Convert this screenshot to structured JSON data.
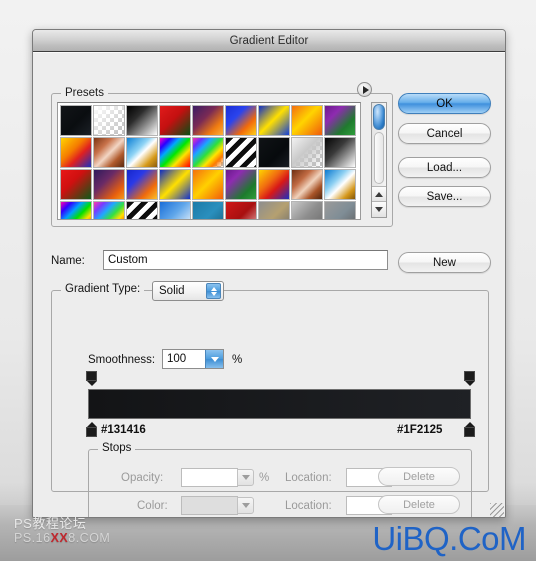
{
  "window": {
    "title": "Gradient Editor"
  },
  "presets": {
    "legend": "Presets",
    "flyout_icon": "flyout-triangle-icon",
    "scrollbar": {
      "thumb_color": "#3f90dd",
      "up_icon": "triangle-up-icon",
      "down_icon": "triangle-down-icon"
    },
    "swatches": [
      {
        "name": "black-dark-navy",
        "css": "linear-gradient(135deg,#121518 0%,#0a0d10 55%,#1b2026 100%)"
      },
      {
        "name": "white-to-transparent",
        "css": "linear-gradient(135deg,#ffffff 0%,rgba(255,255,255,0) 100%)",
        "checker": true
      },
      {
        "name": "black-to-white",
        "css": "linear-gradient(135deg,#000000 0%,#2b2b2b 35%,#ffffff 100%)"
      },
      {
        "name": "red-to-green",
        "css": "linear-gradient(135deg,#e01b1b 0%,#c41010 45%,#0a4d14 100%)"
      },
      {
        "name": "violet-orange",
        "css": "linear-gradient(135deg,#3a1c63 0%,#7a2a55 40%,#f07c10 75%,#fbb03b 100%)"
      },
      {
        "name": "blue-orange",
        "css": "linear-gradient(135deg,#1b2fd6 0%,#2a44ee 35%,#f26a0a 70%,#fdd017 100%)"
      },
      {
        "name": "blue-yellow-blue",
        "css": "linear-gradient(135deg,#0f2fc8 0%,#ffe000 48%,#123fd8 100%)"
      },
      {
        "name": "orange-yellow",
        "css": "linear-gradient(135deg,#f36f12 0%,#ffd400 45%,#f05a0c 100%)"
      },
      {
        "name": "purple-green",
        "css": "linear-gradient(135deg,#6d1a8e 0%,#8e2bb0 30%,#1f7a2e 70%,#2f9e3c 100%)"
      },
      {
        "name": "yellow-orange-blue",
        "css": "linear-gradient(135deg,#ffd400 0%,#f57c00 40%,#e02020 62%,#1a2fc0 100%)"
      },
      {
        "name": "copper",
        "css": "linear-gradient(135deg,#7a3414 0%,#c8724a 30%,#f2d6c4 52%,#b05a2c 75%,#5a2a10 100%)"
      },
      {
        "name": "blue-white-gold",
        "css": "linear-gradient(135deg,#0d7fd4 0%,#8fd4f5 38%,#ffffff 52%,#d79b1a 78%,#8a5c0d 100%)"
      },
      {
        "name": "spectrum",
        "css": "linear-gradient(135deg,#ff00c8 0%,#2a00ff 18%,#00a8ff 34%,#00e800 52%,#ffe400 70%,#ff6a00 85%,#ff0000 100%)"
      },
      {
        "name": "spectrum-transparent",
        "css": "linear-gradient(135deg,#ff2fa8 0%,#6a2cff 16%,#1aa8ff 32%,#2fe03a 50%,#ffe400 66%,#ff7b00 80%,rgba(255,255,255,0) 100%)",
        "checker": true
      },
      {
        "name": "black-white-stripes",
        "css": "repeating-linear-gradient(135deg,#0d0d0d 0 5px,#ffffff 5px 10px)"
      },
      {
        "name": "near-black",
        "css": "linear-gradient(135deg,#101316 0%,#070a0d 60%,#191d23 100%)"
      },
      {
        "name": "silver-transparent",
        "css": "linear-gradient(135deg,#f2f2f2 0%,#c9c9c9 45%,rgba(255,255,255,0) 100%)",
        "checker": true
      },
      {
        "name": "black-to-white-2",
        "css": "linear-gradient(135deg,#050505 0%,#3a3a3a 40%,#ffffff 100%)"
      },
      {
        "name": "red-green-2",
        "css": "linear-gradient(135deg,#e81818 0%,#cf1010 40%,#0d5a18 100%)"
      },
      {
        "name": "violet-orange-2",
        "css": "linear-gradient(135deg,#2e1a5c 0%,#6a2a66 38%,#e8600d 78%,#f59a17 100%)"
      },
      {
        "name": "blue-orange-2",
        "css": "linear-gradient(135deg,#1626cc 0%,#2a3ae8 32%,#ef6a0c 72%,#fbc02d 100%)"
      },
      {
        "name": "blue-yellow-2",
        "css": "linear-gradient(135deg,#0e2cc4 0%,#ffe000 50%,#1130cf 100%)"
      },
      {
        "name": "orange-yellow-2",
        "css": "linear-gradient(135deg,#f4700f 0%,#ffd000 48%,#f25c0a 100%)"
      },
      {
        "name": "purple-green-2",
        "css": "linear-gradient(135deg,#6a1a8c 0%,#8e2bb0 28%,#1d7a2c 72%,#2f9e3c 100%)"
      },
      {
        "name": "yellow-red-blue",
        "css": "linear-gradient(135deg,#ffd400 0%,#f06a10 38%,#d81818 60%,#1c2fc0 100%)"
      },
      {
        "name": "copper-2",
        "css": "linear-gradient(135deg,#6f2f12 0%,#c06a42 32%,#f0d2bc 54%,#a85428 76%,#52250e 100%)"
      },
      {
        "name": "blue-white-gold-2",
        "css": "linear-gradient(135deg,#0b7ad0 0%,#8ed0f2 36%,#ffffff 54%,#d4971a 80%,#835608 100%)"
      },
      {
        "name": "spectrum-2",
        "css": "linear-gradient(135deg,#ff00b4 0%,#3000ff 18%,#00a0ff 36%,#00e000 54%,#ffe000 72%,#ff6400 88%,#ff0000 100%)"
      },
      {
        "name": "spectrum-transparent-2",
        "css": "linear-gradient(135deg,#ff3aa8 0%,#7a3aff 18%,#20a8ff 36%,#35e040 54%,#ffe000 70%,#ff7a00 84%,rgba(255,255,255,0) 100%)",
        "checker": true
      },
      {
        "name": "black-white-stripes-2",
        "css": "repeating-linear-gradient(135deg,#0d0d0d 0 5px,#ffffff 5px 10px)"
      },
      {
        "name": "blue-to-white",
        "css": "linear-gradient(135deg,#1a6ed8 0%,#5fa6ea 45%,#ffffff 100%)"
      },
      {
        "name": "steel-blue",
        "css": "linear-gradient(135deg,#1d7aa8 0%,#2a8fbd 50%,#17607f 100%)"
      },
      {
        "name": "red-fade",
        "css": "linear-gradient(135deg,#d01818 0%,#a81010 50%,#e8b8b8 100%)"
      },
      {
        "name": "grey-gold",
        "css": "linear-gradient(135deg,#8e8e8e 0%,#b5a070 50%,#6e6e6e 100%)"
      },
      {
        "name": "silver-grey",
        "css": "linear-gradient(135deg,#c8c8c8 0%,#8e8e8e 48%,#6a6a6a 100%)"
      },
      {
        "name": "grey-blue",
        "css": "linear-gradient(135deg,#9a9a9a 0%,#7f8d96 50%,#5e5e5e 100%)"
      }
    ]
  },
  "buttons": {
    "ok": "OK",
    "cancel": "Cancel",
    "load": "Load...",
    "save": "Save...",
    "new": "New"
  },
  "name_row": {
    "label": "Name:",
    "value": "Custom"
  },
  "gradient_type": {
    "legend": "Gradient Type:",
    "value": "Solid",
    "stepper_icon": "stepper-arrows-icon"
  },
  "smoothness": {
    "label": "Smoothness:",
    "value": "100",
    "unit": "%",
    "dropdown_icon": "triangle-down-icon"
  },
  "gradient_bar": {
    "start_color": "#131416",
    "end_color": "#1F2125",
    "start_label": "#131416",
    "end_label": "#1F2125",
    "opacity_stop_icon": "opacity-stop-marker-icon",
    "color_stop_icon": "color-stop-marker-icon"
  },
  "stops": {
    "legend": "Stops",
    "opacity_label": "Opacity:",
    "opacity_value": "",
    "opacity_unit": "%",
    "color_label": "Color:",
    "location_label": "Location:",
    "location1_value": "",
    "location2_value": "",
    "location_unit": "%",
    "delete_label": "Delete"
  },
  "watermark": {
    "left_line1": "PS教程论坛",
    "left_line2_a": "PS.16",
    "left_line2_b": "XX",
    "left_line2_c": "8.COM",
    "right": "UiBQ.CoM",
    "right_color": "#1f63c6"
  }
}
